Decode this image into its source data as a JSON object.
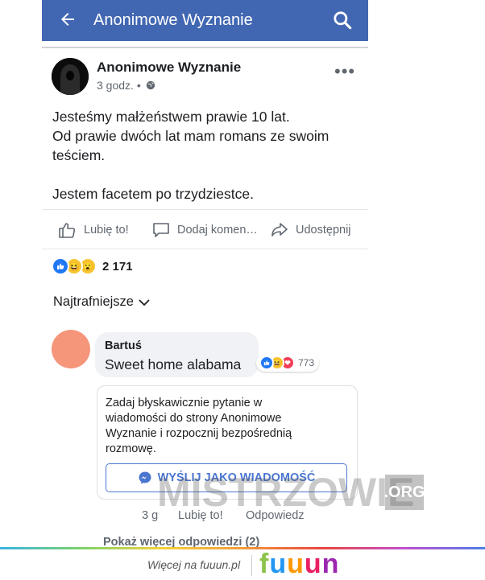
{
  "app_bar": {
    "title": "Anonimowe Wyznanie",
    "color": "#4267b2"
  },
  "post": {
    "author": "Anonimowe Wyznanie",
    "time": "3 godz. •",
    "text_lines": [
      "Jesteśmy małżeństwem prawie 10 lat.",
      "Od prawie dwóch lat mam romans ze swoim",
      "teściem.",
      "",
      "Jestem facetem po trzydziestce."
    ],
    "actions": {
      "like": "Lubię to!",
      "comment": "Dodaj komen…",
      "share": "Udostępnij"
    },
    "reaction_count": "2 171"
  },
  "sort_label": "Najtrafniejsze",
  "comment": {
    "author": "Bartuś",
    "text": "Sweet home alabama",
    "reaction_count": "773",
    "time": "3 g",
    "like": "Lubię to!",
    "reply": "Odpowiedz",
    "avatar_color": "#f59579"
  },
  "messenger_card": {
    "prompt": "Zadaj błyskawicznie pytanie w wiadomości do strony Anonimowe Wyznanie i rozpocznij bezpośrednią rozmowę.",
    "button": "WYŚLIJ JAKO WIADOMOŚĆ"
  },
  "more_replies": "Pokaż więcej odpowiedzi (2)",
  "watermark": {
    "text": "MISTRZOWIE",
    "suffix": ".ORG"
  },
  "footer": {
    "link_text": "Więcej na fuuun.pl",
    "brand_letters": [
      "f",
      "u",
      "u",
      "u",
      "n"
    ]
  }
}
